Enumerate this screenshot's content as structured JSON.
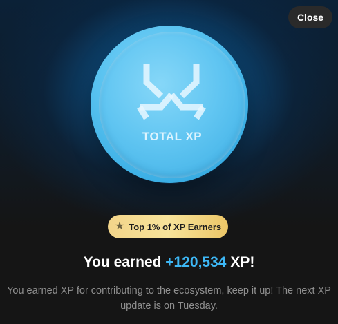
{
  "close_label": "Close",
  "coin": {
    "label": "TOTAL XP",
    "logo_icon": "total-xp-logo-icon"
  },
  "badge": {
    "icon": "star-icon",
    "label": "Top 1% of XP Earners"
  },
  "headline": {
    "prefix": "You earned ",
    "amount": "+120,534",
    "suffix": " XP!"
  },
  "description": "You earned XP for contributing to the ecosystem, keep it up! The next XP update is on Tuesday.",
  "colors": {
    "accent": "#3db7f5",
    "background": "#151515",
    "badge_gold": "#f3d58a",
    "coin_blue": "#58c2f0"
  }
}
